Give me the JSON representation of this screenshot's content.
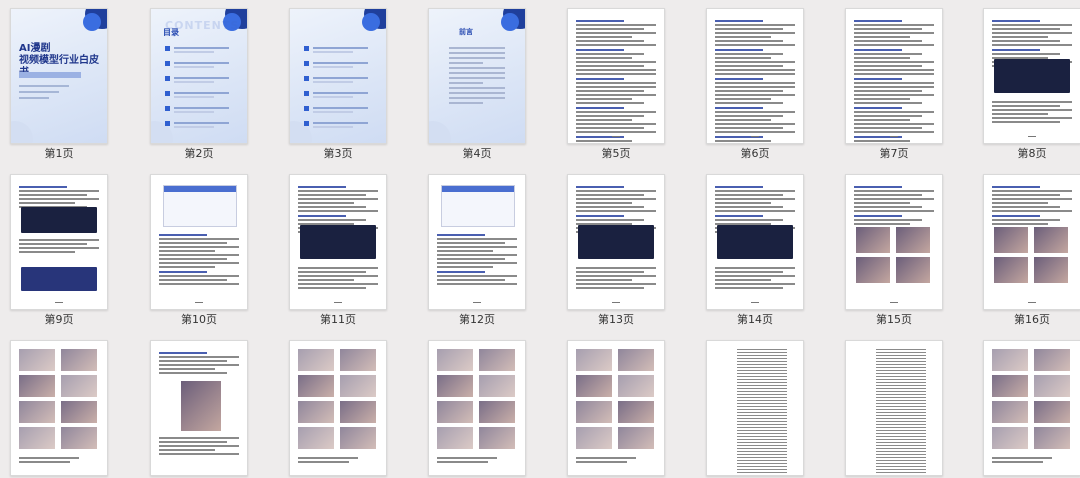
{
  "cover": {
    "title_line1": "AI漫剧",
    "title_line2": "视频模型行业白皮书"
  },
  "toc": {
    "title": "目录",
    "ghost": "CONTENTS"
  },
  "preface": {
    "title": "前言"
  },
  "pages": [
    {
      "label": "第1页",
      "kind": "cover"
    },
    {
      "label": "第2页",
      "kind": "toc"
    },
    {
      "label": "第3页",
      "kind": "toc2"
    },
    {
      "label": "第4页",
      "kind": "preface"
    },
    {
      "label": "第5页",
      "kind": "text"
    },
    {
      "label": "第6页",
      "kind": "text"
    },
    {
      "label": "第7页",
      "kind": "text"
    },
    {
      "label": "第8页",
      "kind": "text-dark"
    },
    {
      "label": "第9页",
      "kind": "text-dark2"
    },
    {
      "label": "第10页",
      "kind": "table"
    },
    {
      "label": "第11页",
      "kind": "text-dark"
    },
    {
      "label": "第12页",
      "kind": "table2"
    },
    {
      "label": "第13页",
      "kind": "text-dark"
    },
    {
      "label": "第14页",
      "kind": "text-dark"
    },
    {
      "label": "第15页",
      "kind": "photos"
    },
    {
      "label": "第16页",
      "kind": "photos2"
    },
    {
      "label": "",
      "kind": "grid-photos"
    },
    {
      "label": "",
      "kind": "mixed"
    },
    {
      "label": "",
      "kind": "grid-photos"
    },
    {
      "label": "",
      "kind": "grid-photos"
    },
    {
      "label": "",
      "kind": "grid-photos"
    },
    {
      "label": "",
      "kind": "dense"
    },
    {
      "label": "",
      "kind": "dense"
    },
    {
      "label": "",
      "kind": "grid-photos"
    }
  ]
}
